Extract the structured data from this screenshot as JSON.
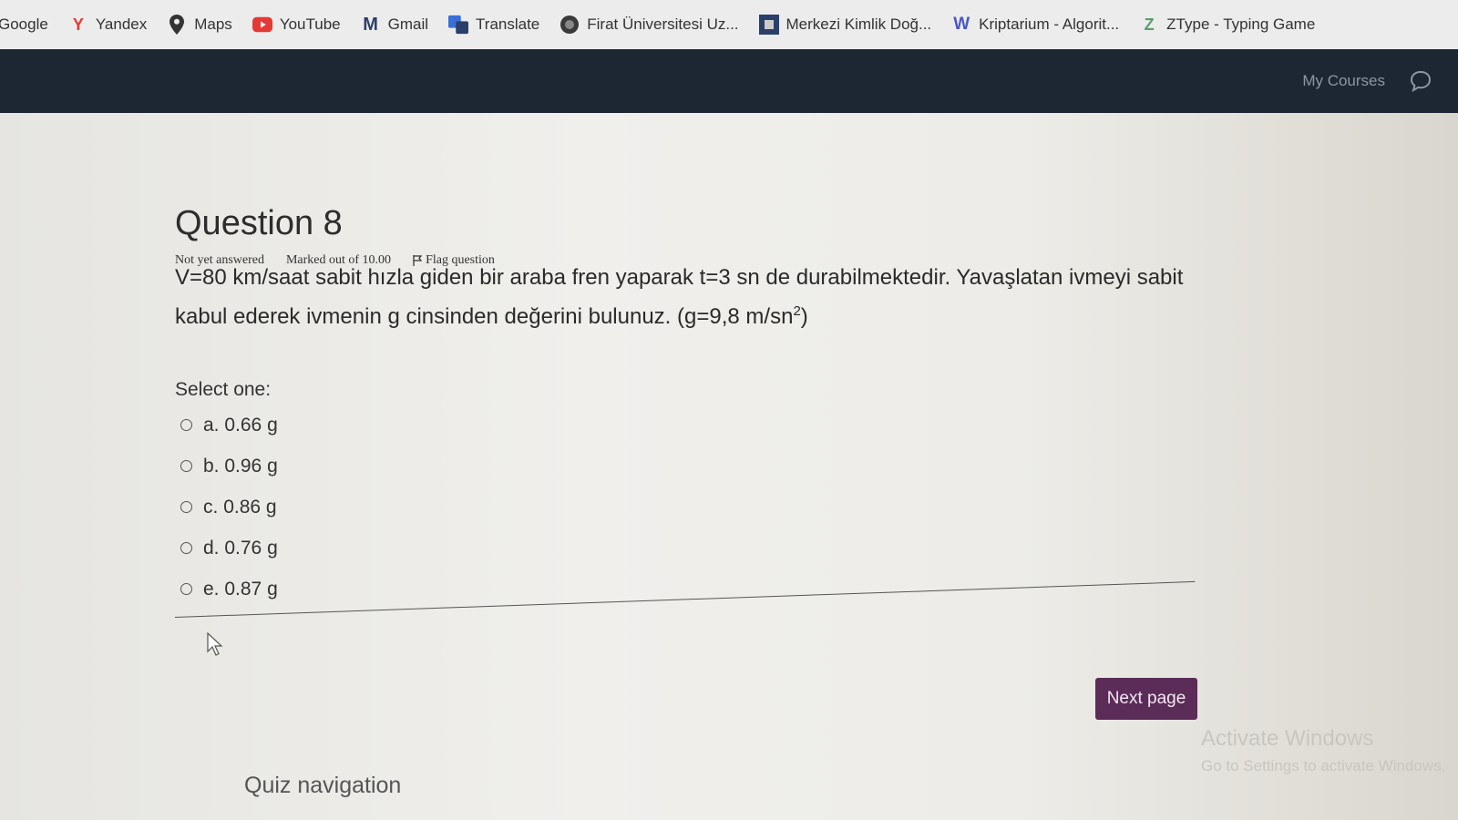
{
  "bookmarks": [
    {
      "label": "Google",
      "icon": "google-icon",
      "color": ""
    },
    {
      "label": "Yandex",
      "icon": "yandex-icon",
      "color": "#e53935"
    },
    {
      "label": "Maps",
      "icon": "maps-pin-icon",
      "color": "#333"
    },
    {
      "label": "YouTube",
      "icon": "youtube-icon",
      "color": "#e53935"
    },
    {
      "label": "Gmail",
      "icon": "gmail-icon",
      "color": "#2b3f6b"
    },
    {
      "label": "Translate",
      "icon": "translate-icon",
      "color": "#3b6fd8"
    },
    {
      "label": "Firat Üniversitesi Uz...",
      "icon": "university-icon",
      "color": "#333"
    },
    {
      "label": "Merkezi Kimlik Doğ...",
      "icon": "identity-icon",
      "color": "#2b3f6b"
    },
    {
      "label": "Kriptarium - Algorit...",
      "icon": "kriptarium-icon",
      "color": "#4a56c4"
    },
    {
      "label": "ZType - Typing Game",
      "icon": "ztype-icon",
      "color": "#5aa06a"
    }
  ],
  "navbar": {
    "my_courses": "My Courses",
    "chat_icon": "chat-bubble-icon"
  },
  "question": {
    "title": "Question 8",
    "status": "Not yet answered",
    "marks": "Marked out of 10.00",
    "flag": "Flag question",
    "text_main": "V=80 km/saat sabit hızla giden bir araba fren yaparak t=3 sn de durabilmektedir. Yavaşlatan ivmeyi sabit kabul ederek ivmenin g cinsinden değerini bulunuz.",
    "text_given": "(g=9,8 m/sn",
    "text_sup": "2",
    "text_close": ")",
    "select_one": "Select one:",
    "options": [
      {
        "letter": "a.",
        "value": "0.66 g"
      },
      {
        "letter": "b.",
        "value": "0.96 g"
      },
      {
        "letter": "c.",
        "value": "0.86 g"
      },
      {
        "letter": "d.",
        "value": "0.76 g"
      },
      {
        "letter": "e.",
        "value": "0.87 g"
      }
    ]
  },
  "next_button": "Next page",
  "watermark": {
    "line1": "Activate Windows",
    "line2": "Go to Settings to activate Windows."
  },
  "quiz_navigation": "Quiz navigation",
  "colors": {
    "navbar": "#1d2733",
    "next_button": "#5b2c58"
  }
}
